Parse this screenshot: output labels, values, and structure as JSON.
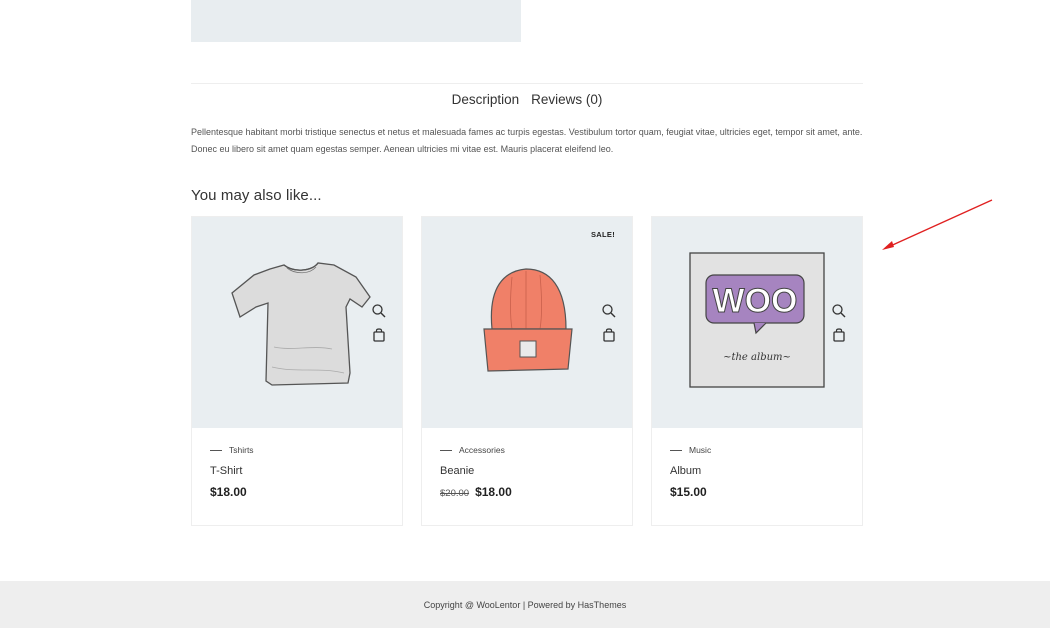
{
  "tabs": {
    "description": "Description",
    "reviews": "Reviews (0)"
  },
  "description_text": "Pellentesque habitant morbi tristique senectus et netus et malesuada fames ac turpis egestas. Vestibulum tortor quam, feugiat vitae, ultricies eget, tempor sit amet, ante. Donec eu libero sit amet quam egestas semper. Aenean ultricies mi vitae est. Mauris placerat eleifend leo.",
  "related": {
    "title": "You may also like...",
    "products": [
      {
        "category": "Tshirts",
        "name": "T-Shirt",
        "price": "$18.00",
        "old_price": "",
        "badge": "",
        "icon": "tshirt-image"
      },
      {
        "category": "Accessories",
        "name": "Beanie",
        "price": "$18.00",
        "old_price": "$20.00",
        "badge": "SALE!",
        "icon": "beanie-image"
      },
      {
        "category": "Music",
        "name": "Album",
        "price": "$15.00",
        "old_price": "",
        "badge": "",
        "icon": "album-image",
        "album_logo": "WOO",
        "album_subtitle": "~the album~"
      }
    ]
  },
  "footer": {
    "copyright": "Copyright @ WooLentor | Powered by HasThemes"
  },
  "colors": {
    "thumb_bg": "#e9eef1",
    "annotation_arrow": "#e02020",
    "footer_bg": "#eeeeee"
  }
}
